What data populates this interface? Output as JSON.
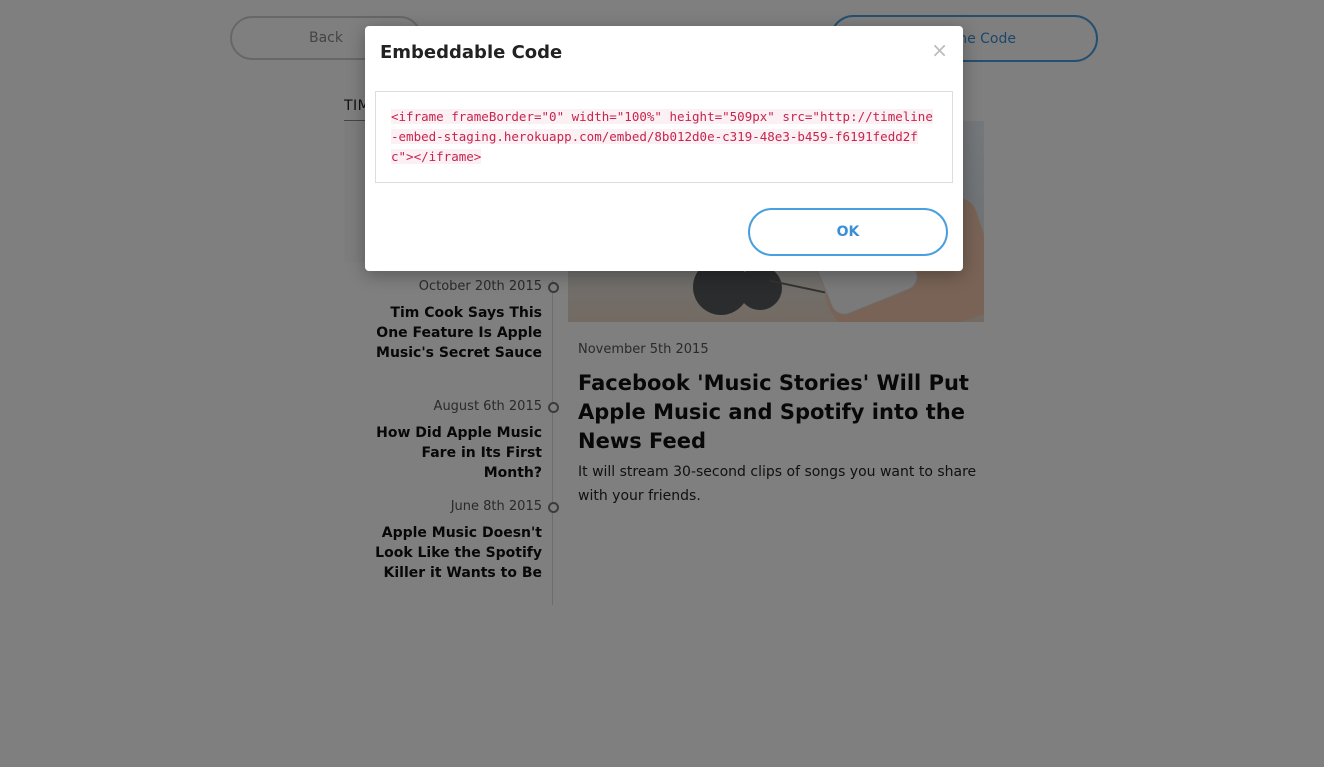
{
  "header": {
    "back_label": "Back",
    "embed_label": "Get Timeline Code"
  },
  "timeline": {
    "title": "TIMELINE",
    "items": [
      {
        "date": "October 20th 2015",
        "headline": "Tim Cook Says This One Feature Is Apple Music's Secret Sauce"
      },
      {
        "date": "August 6th 2015",
        "headline": "How Did Apple Music Fare in Its First Month?"
      },
      {
        "date": "June 8th 2015",
        "headline": "Apple Music Doesn't Look Like the Spotify Killer it Wants to Be"
      }
    ]
  },
  "article": {
    "date": "November 5th 2015",
    "headline": "Facebook 'Music Stories' Will Put Apple Music and Spotify into the News Feed",
    "summary": "It will stream 30-second clips of songs you want to share with your friends."
  },
  "modal": {
    "title": "Embeddable Code",
    "close_glyph": "×",
    "code": "<iframe frameBorder=\"0\" width=\"100%\" height=\"509px\" src=\"http://timeline-embed-staging.herokuapp.com/embed/8b012d0e-c319-48e3-b459-f6191fedd2fc\"></iframe>",
    "ok_label": "OK"
  },
  "colors": {
    "accent": "#4a9fe0",
    "code_text": "#c7254e",
    "overlay": "rgba(0,0,0,0.5)"
  }
}
